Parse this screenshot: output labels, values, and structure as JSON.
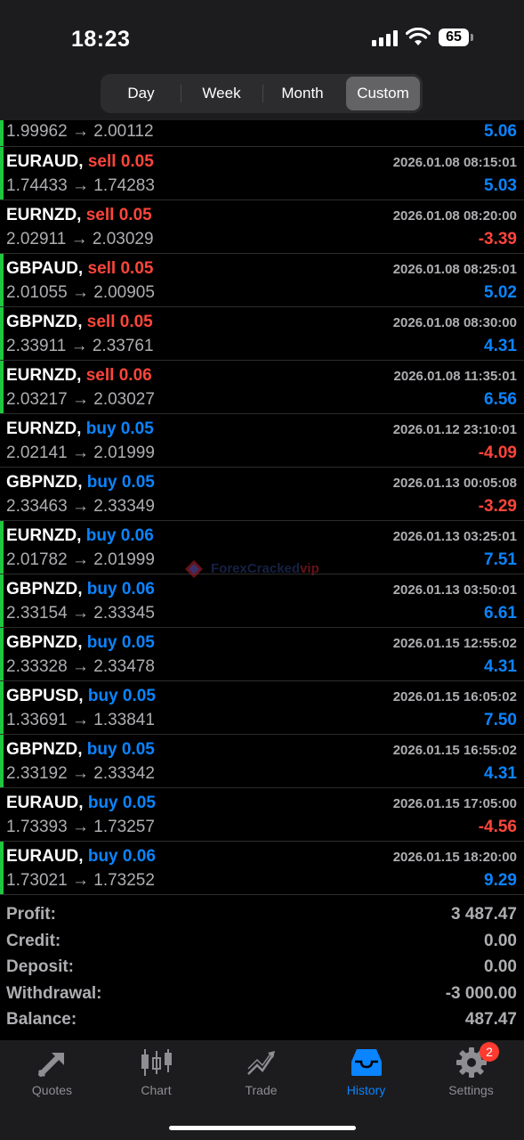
{
  "status": {
    "time": "18:23",
    "battery": "65"
  },
  "segments": [
    {
      "label": "Day",
      "active": false
    },
    {
      "label": "Week",
      "active": false
    },
    {
      "label": "Month",
      "active": false
    },
    {
      "label": "Custom",
      "active": true
    }
  ],
  "deals": [
    {
      "symbol": "",
      "op": "",
      "lots": "",
      "time": "",
      "open": "1.99962",
      "close": "2.00112",
      "profit": "5.06"
    },
    {
      "symbol": "EURAUD,",
      "op": "sell",
      "lots": "0.05",
      "time": "2026.01.08 08:15:01",
      "open": "1.74433",
      "close": "1.74283",
      "profit": "5.03"
    },
    {
      "symbol": "EURNZD,",
      "op": "sell",
      "lots": "0.05",
      "time": "2026.01.08 08:20:00",
      "open": "2.02911",
      "close": "2.03029",
      "profit": "-3.39"
    },
    {
      "symbol": "GBPAUD,",
      "op": "sell",
      "lots": "0.05",
      "time": "2026.01.08 08:25:01",
      "open": "2.01055",
      "close": "2.00905",
      "profit": "5.02"
    },
    {
      "symbol": "GBPNZD,",
      "op": "sell",
      "lots": "0.05",
      "time": "2026.01.08 08:30:00",
      "open": "2.33911",
      "close": "2.33761",
      "profit": "4.31"
    },
    {
      "symbol": "EURNZD,",
      "op": "sell",
      "lots": "0.06",
      "time": "2026.01.08 11:35:01",
      "open": "2.03217",
      "close": "2.03027",
      "profit": "6.56"
    },
    {
      "symbol": "EURNZD,",
      "op": "buy",
      "lots": "0.05",
      "time": "2026.01.12 23:10:01",
      "open": "2.02141",
      "close": "2.01999",
      "profit": "-4.09"
    },
    {
      "symbol": "GBPNZD,",
      "op": "buy",
      "lots": "0.05",
      "time": "2026.01.13 00:05:08",
      "open": "2.33463",
      "close": "2.33349",
      "profit": "-3.29"
    },
    {
      "symbol": "EURNZD,",
      "op": "buy",
      "lots": "0.06",
      "time": "2026.01.13 03:25:01",
      "open": "2.01782",
      "close": "2.01999",
      "profit": "7.51"
    },
    {
      "symbol": "GBPNZD,",
      "op": "buy",
      "lots": "0.06",
      "time": "2026.01.13 03:50:01",
      "open": "2.33154",
      "close": "2.33345",
      "profit": "6.61"
    },
    {
      "symbol": "GBPNZD,",
      "op": "buy",
      "lots": "0.05",
      "time": "2026.01.15 12:55:02",
      "open": "2.33328",
      "close": "2.33478",
      "profit": "4.31"
    },
    {
      "symbol": "GBPUSD,",
      "op": "buy",
      "lots": "0.05",
      "time": "2026.01.15 16:05:02",
      "open": "1.33691",
      "close": "1.33841",
      "profit": "7.50"
    },
    {
      "symbol": "GBPNZD,",
      "op": "buy",
      "lots": "0.05",
      "time": "2026.01.15 16:55:02",
      "open": "2.33192",
      "close": "2.33342",
      "profit": "4.31"
    },
    {
      "symbol": "EURAUD,",
      "op": "buy",
      "lots": "0.05",
      "time": "2026.01.15 17:05:00",
      "open": "1.73393",
      "close": "1.73257",
      "profit": "-4.56"
    },
    {
      "symbol": "EURAUD,",
      "op": "buy",
      "lots": "0.06",
      "time": "2026.01.15 18:20:00",
      "open": "1.73021",
      "close": "1.73252",
      "profit": "9.29"
    }
  ],
  "arrow": "→",
  "watermark": {
    "text": "ForexCracked",
    "suffix": "vip"
  },
  "summary": [
    {
      "label": "Profit:",
      "value": "3 487.47"
    },
    {
      "label": "Credit:",
      "value": "0.00"
    },
    {
      "label": "Deposit:",
      "value": "0.00"
    },
    {
      "label": "Withdrawal:",
      "value": "-3 000.00"
    },
    {
      "label": "Balance:",
      "value": "487.47"
    }
  ],
  "tabs": [
    {
      "label": "Quotes",
      "icon": "quotes-icon",
      "active": false
    },
    {
      "label": "Chart",
      "icon": "chart-icon",
      "active": false
    },
    {
      "label": "Trade",
      "icon": "trade-icon",
      "active": false
    },
    {
      "label": "History",
      "icon": "history-icon",
      "active": true
    },
    {
      "label": "Settings",
      "icon": "settings-icon",
      "active": false,
      "badge": "2"
    }
  ],
  "colors": {
    "profit_positive": "#0a84ff",
    "profit_negative": "#ff453a",
    "sell": "#ff453a",
    "buy": "#0a84ff",
    "profit_bar": "#1fc73f",
    "active_tab": "#0a84ff"
  }
}
